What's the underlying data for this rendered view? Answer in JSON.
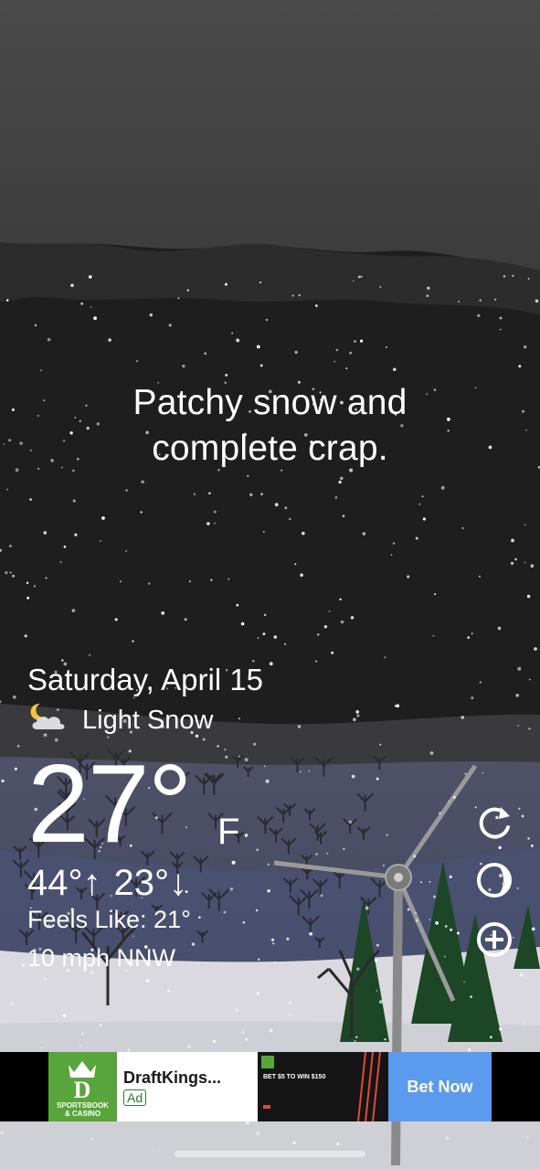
{
  "headline": {
    "line1": "Patchy snow and",
    "line2": "complete crap."
  },
  "weather": {
    "date": "Saturday, April 15",
    "condition_icon": "moon-cloud-snow-icon",
    "condition": "Light Snow",
    "temperature": "27°",
    "unit": "F",
    "high": "44°↑",
    "low": "23°↓",
    "feels_like": "Feels Like: 21°",
    "wind": "10 mph NNW"
  },
  "side_buttons": [
    {
      "icon": "refresh-icon"
    },
    {
      "icon": "moon-phase-icon"
    },
    {
      "icon": "add-location-icon"
    }
  ],
  "ad": {
    "logo_text_1": "SPORTSBOOK",
    "logo_text_2": "& CASINO",
    "title": "DraftKings...",
    "badge": "Ad",
    "promo": "BET $5 TO WIN $150",
    "cta": "Bet Now"
  },
  "colors": {
    "sky": "#1f1f1f",
    "ad_green": "#58a53b",
    "cta_blue": "#5b9bee"
  }
}
